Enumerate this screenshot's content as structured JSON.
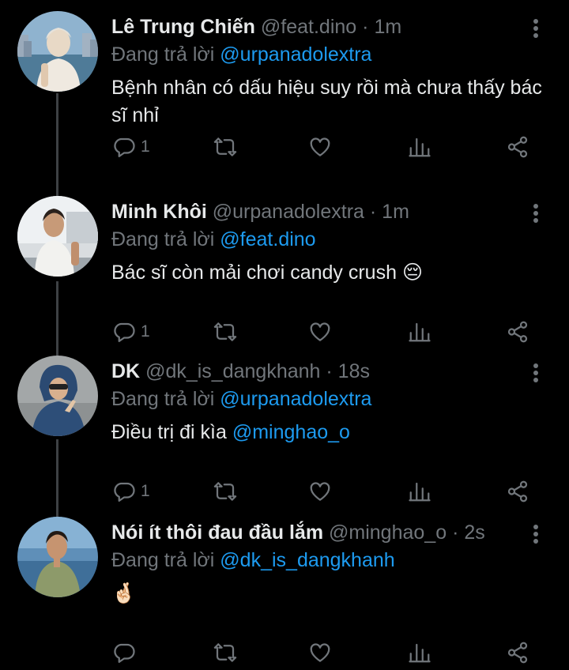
{
  "reply_prefix": "Đang trả lời",
  "tweets": [
    {
      "name": "Lê Trung Chiến",
      "handle": "@feat.dino",
      "dot": "·",
      "time": "1m",
      "reply_to": "@urpanadolextra",
      "text": "Bệnh nhân có dấu hiệu suy rồi mà chưa thấy bác sĩ nhỉ",
      "mention": "",
      "emoji": "",
      "reply_count": "1"
    },
    {
      "name": "Minh Khôi",
      "handle": "@urpanadolextra",
      "dot": "·",
      "time": "1m",
      "reply_to": "@feat.dino",
      "text": "Bác sĩ còn mải chơi candy crush ",
      "mention": "",
      "emoji": "😔",
      "reply_count": "1"
    },
    {
      "name": "DK",
      "handle": "@dk_is_dangkhanh",
      "dot": "·",
      "time": "18s",
      "reply_to": "@urpanadolextra",
      "text": "Điều trị đi kìa ",
      "mention": "@minghao_o",
      "emoji": "",
      "reply_count": "1"
    },
    {
      "name": "Nói ít thôi đau đầu lắm",
      "handle": "@minghao_o",
      "dot": "·",
      "time": "2s",
      "reply_to": "@dk_is_dangkhanh",
      "text": "",
      "mention": "",
      "emoji": "🤞🏻",
      "reply_count": ""
    }
  ],
  "icons": [
    "reply-icon",
    "retweet-icon",
    "like-icon",
    "views-icon",
    "share-icon",
    "more-options-icon"
  ],
  "colors": {
    "background": "#000000",
    "mention": "#1d9bf0",
    "muted": "#71767b",
    "text": "#e7e9ea"
  }
}
